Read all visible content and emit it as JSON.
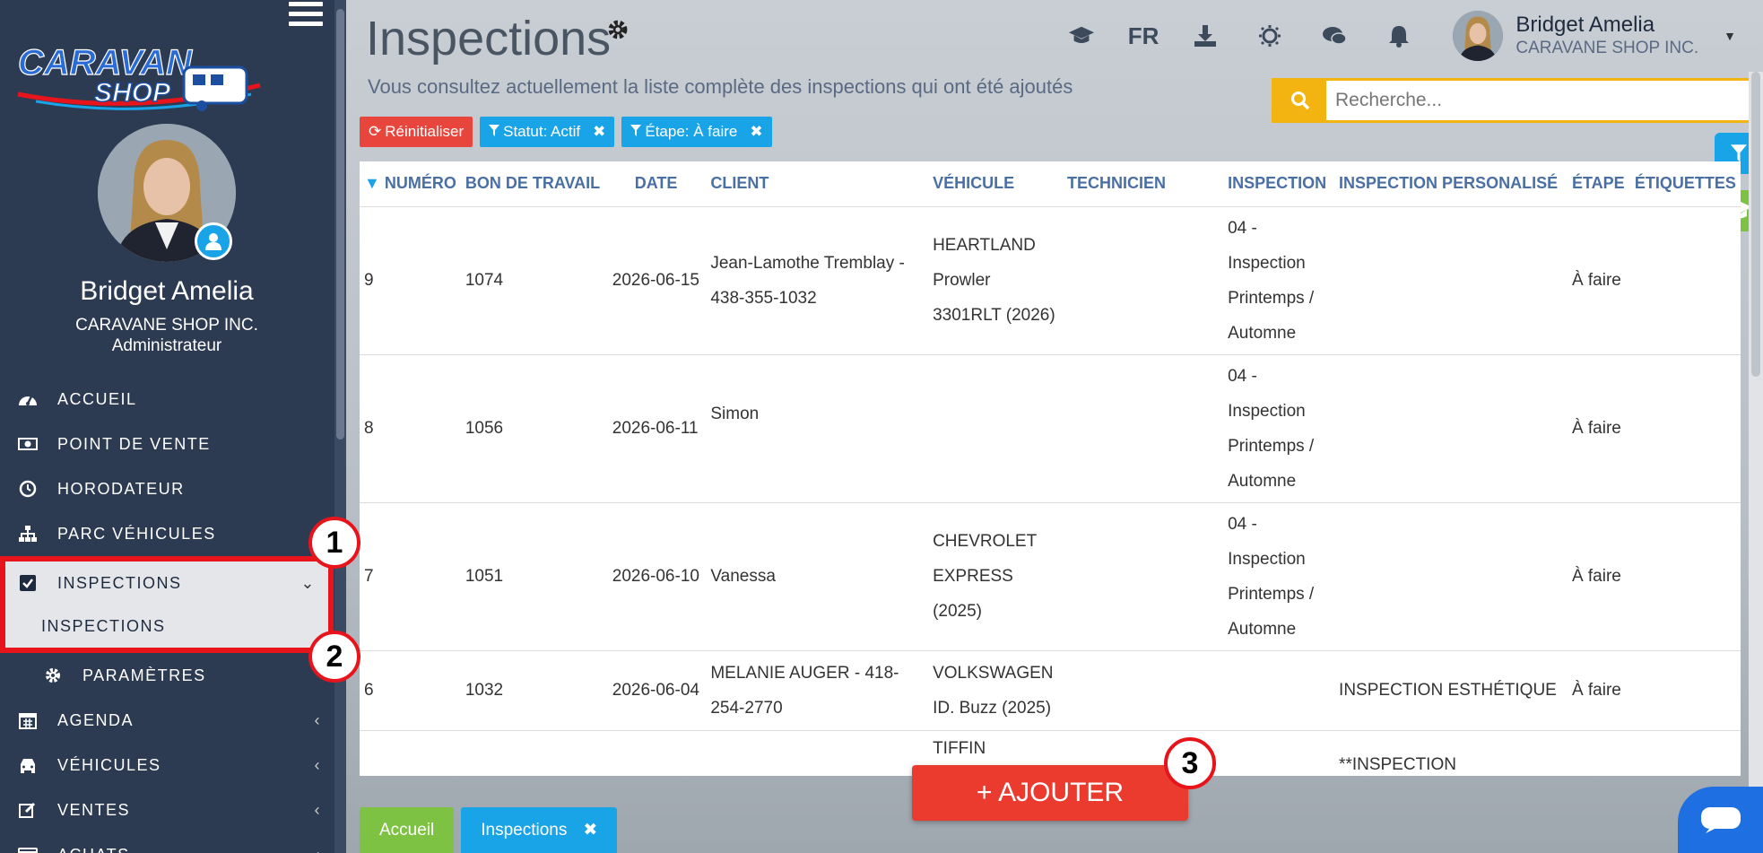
{
  "sidebar": {
    "logo_line1": "CARAVAN",
    "logo_line2": "SHOP",
    "user_name": "Bridget Amelia",
    "company": "CARAVANE SHOP INC.",
    "role": "Administrateur",
    "items": [
      {
        "label": "ACCUEIL",
        "icon": "dashboard-icon"
      },
      {
        "label": "POINT DE VENTE",
        "icon": "money-icon"
      },
      {
        "label": "HORODATEUR",
        "icon": "clock-icon"
      },
      {
        "label": "PARC VÉHICULES",
        "icon": "sitemap-icon"
      },
      {
        "label": "INSPECTIONS",
        "icon": "checkbox-icon",
        "chevron": "⌄"
      },
      {
        "label": "INSPECTIONS"
      },
      {
        "label": "PARAMÈTRES",
        "icon": "gear-icon"
      },
      {
        "label": "AGENDA",
        "icon": "calendar-icon",
        "chevron": "‹"
      },
      {
        "label": "VÉHICULES",
        "icon": "car-icon",
        "chevron": "‹"
      },
      {
        "label": "VENTES",
        "icon": "edit-icon",
        "chevron": "‹"
      },
      {
        "label": "ACHATS",
        "icon": "card-icon",
        "chevron": "‹"
      }
    ]
  },
  "markers": [
    "1",
    "2",
    "3"
  ],
  "header": {
    "title": "Inspections",
    "subtitle": "Vous consultez actuellement la liste complète des inspections qui ont été ajoutés",
    "language": "FR",
    "user_name": "Bridget Amelia",
    "user_company": "CARAVANE SHOP INC."
  },
  "search": {
    "placeholder": "Recherche..."
  },
  "filters": {
    "reset": "Réinitialiser",
    "status": "Statut: Actif",
    "step": "Étape: À faire"
  },
  "table": {
    "columns": [
      "NUMÉRO",
      "BON DE TRAVAIL",
      "DATE",
      "CLIENT",
      "VÉHICULE",
      "TECHNICIEN",
      "INSPECTION",
      "INSPECTION PERSONALISÉ",
      "ÉTAPE",
      "ÉTIQUETTES"
    ],
    "rows": [
      {
        "numero": "9",
        "bon": "1074",
        "date": "2026-06-15",
        "client": "Jean-Lamothe Tremblay - 438-355-1032",
        "vehicule": "HEARTLAND Prowler 3301RLT (2026)",
        "technicien": "",
        "inspection": "04 - Inspection Printemps / Automne",
        "perso": "",
        "etape": "À faire"
      },
      {
        "numero": "8",
        "bon": "1056",
        "date": "2026-06-11",
        "client": "Simon",
        "vehicule": "",
        "technicien": "",
        "inspection": "04 - Inspection Printemps / Automne",
        "perso": "",
        "etape": "À faire"
      },
      {
        "numero": "7",
        "bon": "1051",
        "date": "2026-06-10",
        "client": "Vanessa",
        "vehicule": "CHEVROLET EXPRESS (2025)",
        "technicien": "",
        "inspection": "04 - Inspection Printemps / Automne",
        "perso": "",
        "etape": "À faire"
      },
      {
        "numero": "6",
        "bon": "1032",
        "date": "2026-06-04",
        "client": "MELANIE AUGER - 418-254-2770",
        "vehicule": "VOLKSWAGEN ID. Buzz (2025)",
        "technicien": "",
        "inspection": "",
        "perso": "INSPECTION ESTHÉTIQUE",
        "etape": "À faire"
      },
      {
        "numero": "",
        "bon": "",
        "date": "",
        "client": "",
        "vehicule": "TIFFIN",
        "technicien": "",
        "inspection": "",
        "perso": "**INSPECTION",
        "etape": ""
      }
    ]
  },
  "add_button": "+ AJOUTER",
  "footer_tabs": {
    "home": "Accueil",
    "current": "Inspections"
  },
  "colors": {
    "sidebar": "#2c3a52",
    "accent": "#19a4e8",
    "danger": "#e8453c",
    "warning": "#f3b411",
    "success": "#7dc242",
    "highlight": "#e8141c"
  }
}
